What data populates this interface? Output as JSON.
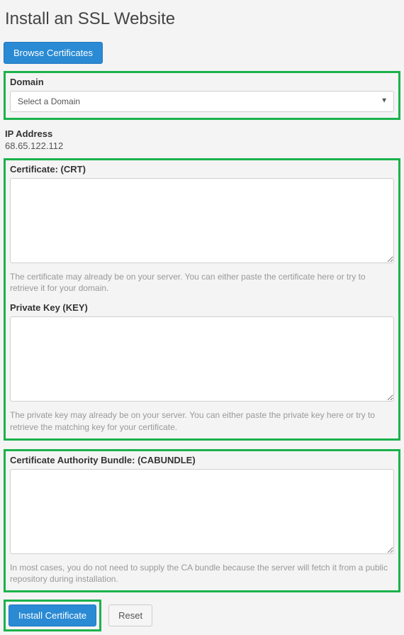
{
  "page": {
    "title": "Install an SSL Website"
  },
  "buttons": {
    "browse": "Browse Certificates",
    "install": "Install Certificate",
    "reset": "Reset"
  },
  "domain": {
    "label": "Domain",
    "selected": "Select a Domain"
  },
  "ip": {
    "label": "IP Address",
    "value": "68.65.122.112"
  },
  "crt": {
    "label": "Certificate: (CRT)",
    "helper": "The certificate may already be on your server. You can either paste the certificate here or try to retrieve it for your domain."
  },
  "key": {
    "label": "Private Key (KEY)",
    "helper": "The private key may already be on your server. You can either paste the private key here or try to retrieve the matching key for your certificate."
  },
  "cabundle": {
    "label": "Certificate Authority Bundle: (CABUNDLE)",
    "helper": "In most cases, you do not need to supply the CA bundle because the server will fetch it from a public repository during installation."
  }
}
